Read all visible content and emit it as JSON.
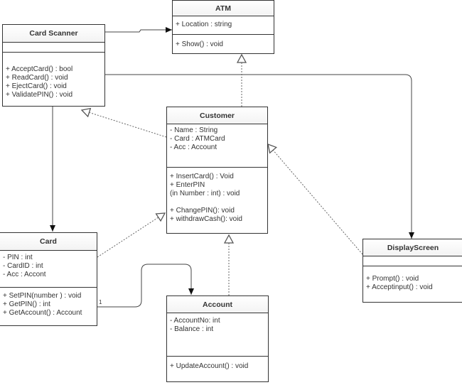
{
  "diagram": {
    "type": "UML class diagram",
    "classes": {
      "atm": {
        "name": "ATM",
        "attributes": [
          "+ Location : string"
        ],
        "methods": [
          "+ Show() : void"
        ]
      },
      "card_scanner": {
        "name": "Card Scanner",
        "attributes": [],
        "methods": [
          "+ AcceptCard() : bool",
          "+ ReadCard() : void",
          "+ EjectCard() : void",
          "+ ValidatePIN() : void"
        ]
      },
      "customer": {
        "name": "Customer",
        "attributes": [
          "- Name : String",
          "- Card : ATMCard",
          "- Acc : Account"
        ],
        "methods": [
          "+ InsertCard() : Void",
          "+ EnterPIN",
          "(in Number : int) : void",
          "",
          "+ ChangePIN(): void",
          "+ withdrawCash(): void"
        ]
      },
      "card": {
        "name": "Card",
        "attributes": [
          "- PIN : int",
          "- CardID : int",
          "- Acc : Accont"
        ],
        "methods": [
          "+ SetPIN(number ) : void",
          "+ GetPIN() : int",
          "+ GetAccount() : Account"
        ]
      },
      "account": {
        "name": "Account",
        "attributes": [
          "- AccountNo: int",
          "- Balance : int"
        ],
        "methods": [
          "+ UpdateAccount() : void"
        ]
      },
      "display_screen": {
        "name": "DisplayScreen",
        "attributes": [],
        "methods": [
          "+ Prompt() : void",
          "+ Acceptinput() : void"
        ]
      }
    },
    "relationships": [
      {
        "from": "Card Scanner",
        "to": "ATM",
        "kind": "association"
      },
      {
        "from": "Card Scanner",
        "to": "DisplayScreen",
        "kind": "association"
      },
      {
        "from": "Card Scanner",
        "to": "Card",
        "kind": "association"
      },
      {
        "from": "Customer",
        "to": "ATM",
        "kind": "dependency-realization"
      },
      {
        "from": "Customer",
        "to": "Card Scanner",
        "kind": "dependency-realization"
      },
      {
        "from": "Card",
        "to": "Customer",
        "kind": "dependency-realization"
      },
      {
        "from": "Account",
        "to": "Customer",
        "kind": "dependency-realization"
      },
      {
        "from": "DisplayScreen",
        "to": "Customer",
        "kind": "dependency-realization"
      },
      {
        "from": "Card",
        "to": "Account",
        "kind": "association",
        "multiplicity": "1"
      }
    ],
    "colors": {
      "line": "#333333",
      "dashed": "#666666",
      "background": "#ffffff"
    }
  }
}
